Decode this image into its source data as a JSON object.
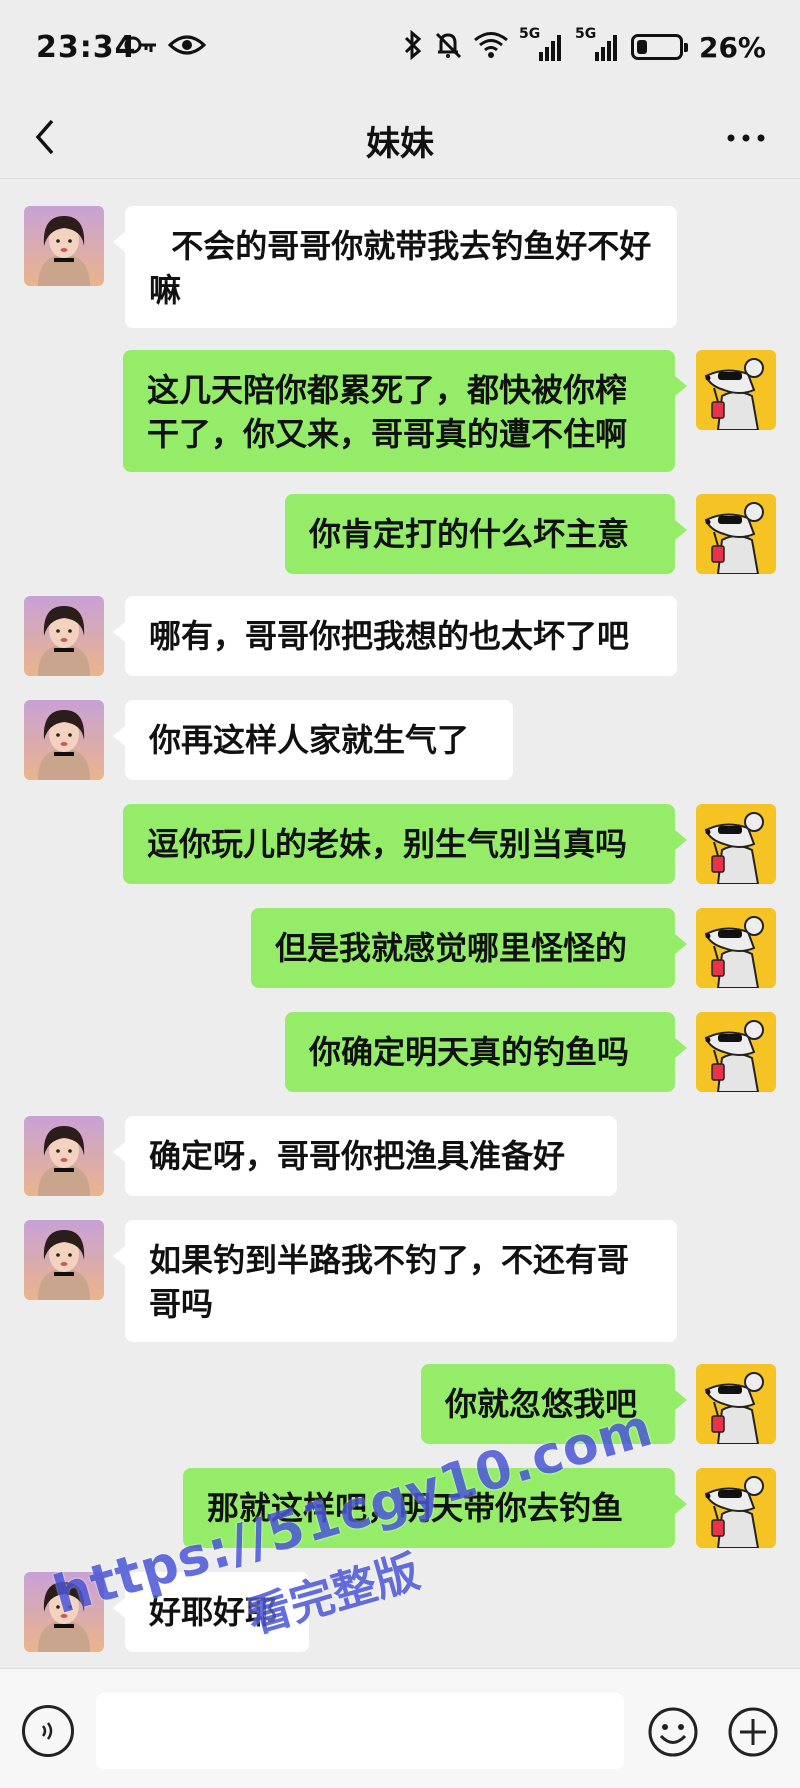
{
  "status_bar": {
    "time": "23:34",
    "network_1": "5G",
    "network_2": "5G",
    "battery_percent": "26%",
    "battery_level": 0.26,
    "icons": [
      "key-icon",
      "eye-icon",
      "bluetooth-icon",
      "mute-icon",
      "wifi-icon",
      "signal-icon",
      "signal-icon",
      "battery-icon"
    ]
  },
  "header": {
    "title": "妹妹",
    "back_icon": "chevron-left-icon",
    "more_icon": "more-icon"
  },
  "messages": [
    {
      "from": "other",
      "text": "  不会的哥哥你就带我去钓鱼好不好嘛"
    },
    {
      "from": "me",
      "text": "这几天陪你都累死了，都快被你榨干了，你又来，哥哥真的遭不住啊"
    },
    {
      "from": "me",
      "text": "你肯定打的什么坏主意"
    },
    {
      "from": "other",
      "text": "哪有，哥哥你把我想的也太坏了吧"
    },
    {
      "from": "other",
      "text": "你再这样人家就生气了"
    },
    {
      "from": "me",
      "text": "逗你玩儿的老妹，别生气别当真吗"
    },
    {
      "from": "me",
      "text": "但是我就感觉哪里怪怪的"
    },
    {
      "from": "me",
      "text": "你确定明天真的钓鱼吗"
    },
    {
      "from": "other",
      "text": "确定呀，哥哥你把渔具准备好"
    },
    {
      "from": "other",
      "text": "如果钓到半路我不钓了，不还有哥哥吗"
    },
    {
      "from": "me",
      "text": "你就忽悠我吧"
    },
    {
      "from": "me",
      "text": "那就这样吧，明天带你去钓鱼"
    },
    {
      "from": "other",
      "text": "好耶好耶"
    }
  ],
  "input_bar": {
    "voice_icon": "voice-icon",
    "text_value": "",
    "emoji_icon": "emoji-icon",
    "plus_icon": "plus-icon"
  },
  "watermark": {
    "url": "https://51cgy10.com",
    "text": "看完整版"
  },
  "colors": {
    "background": "#ededed",
    "my_bubble": "#95ec69",
    "their_bubble": "#ffffff",
    "watermark": "#4a56d8"
  }
}
